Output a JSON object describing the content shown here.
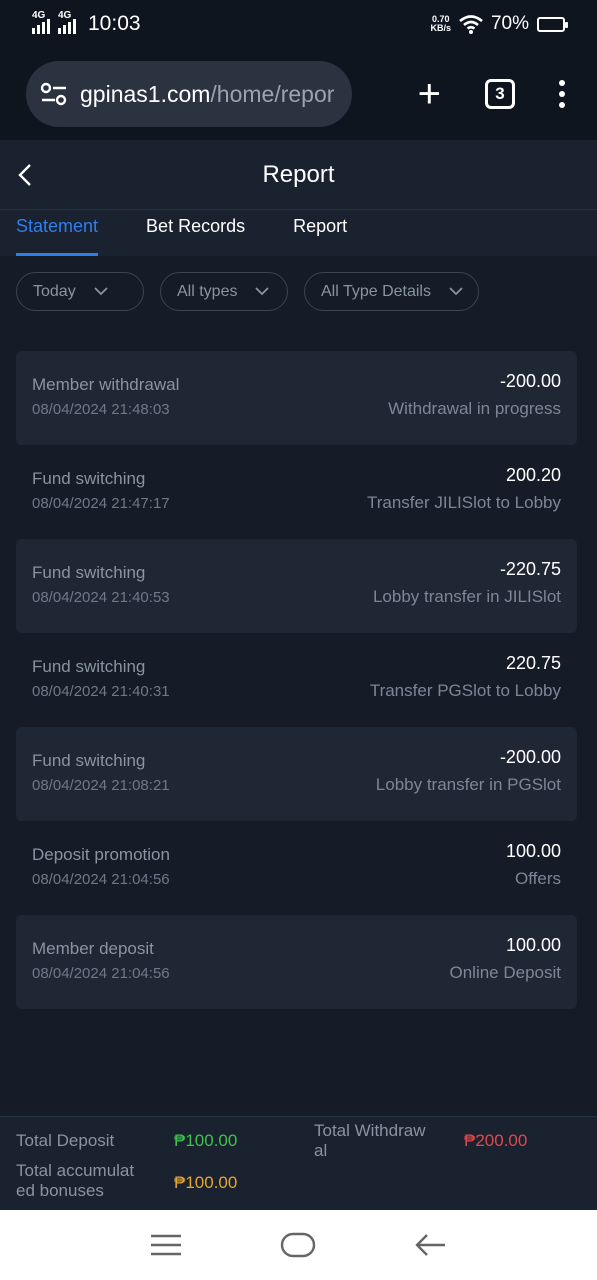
{
  "status_bar": {
    "net1": "4G",
    "net2": "4G",
    "time": "10:03",
    "speed_value": "0.70",
    "speed_unit": "KB/s",
    "battery": "70%",
    "battery_level": 0.7
  },
  "browser": {
    "url_domain": "gpinas1.com",
    "url_path": "/home/repor",
    "tab_count": "3"
  },
  "page": {
    "title": "Report"
  },
  "tabs": [
    {
      "label": "Statement",
      "active": true
    },
    {
      "label": "Bet Records",
      "active": false
    },
    {
      "label": "Report",
      "active": false
    }
  ],
  "filters": [
    {
      "label": "Today"
    },
    {
      "label": "All types"
    },
    {
      "label": "All Type Details"
    }
  ],
  "transactions": [
    {
      "title": "Member withdrawal",
      "time": "08/04/2024 21:48:03",
      "amount": "-200.00",
      "desc": "Withdrawal in progress"
    },
    {
      "title": "Fund switching",
      "time": "08/04/2024 21:47:17",
      "amount": "200.20",
      "desc": "Transfer JILISlot to Lobby"
    },
    {
      "title": "Fund switching",
      "time": "08/04/2024 21:40:53",
      "amount": "-220.75",
      "desc": "Lobby transfer in JILISlot"
    },
    {
      "title": "Fund switching",
      "time": "08/04/2024 21:40:31",
      "amount": "220.75",
      "desc": "Transfer PGSlot to Lobby"
    },
    {
      "title": "Fund switching",
      "time": "08/04/2024 21:08:21",
      "amount": "-200.00",
      "desc": "Lobby transfer in PGSlot"
    },
    {
      "title": "Deposit promotion",
      "time": "08/04/2024 21:04:56",
      "amount": "100.00",
      "desc": "Offers"
    },
    {
      "title": "Member deposit",
      "time": "08/04/2024 21:04:56",
      "amount": "100.00",
      "desc": "Online Deposit"
    }
  ],
  "totals": {
    "deposit_label": "Total Deposit",
    "deposit_value": "₱100.00",
    "withdraw_label_1": "Total Withdraw",
    "withdraw_label_2": "al",
    "withdraw_value": "₱200.00",
    "bonus_label_1": "Total accumulat",
    "bonus_label_2": "ed bonuses",
    "bonus_value": "₱100.00"
  },
  "colors": {
    "accent": "#2f7ef0",
    "deposit": "#3ec24a",
    "withdraw": "#e0484c",
    "bonus": "#e6a532"
  },
  "icons": {
    "site_settings": "tune-icon",
    "new_tab": "plus-icon",
    "tabs": "tab-count-icon",
    "menu": "kebab-menu-icon",
    "back": "chevron-left-icon",
    "filter_chevron": "chevron-down-icon",
    "nav_recents": "menu-lines-icon",
    "nav_home": "home-pill-icon",
    "nav_back": "arrow-left-icon"
  }
}
